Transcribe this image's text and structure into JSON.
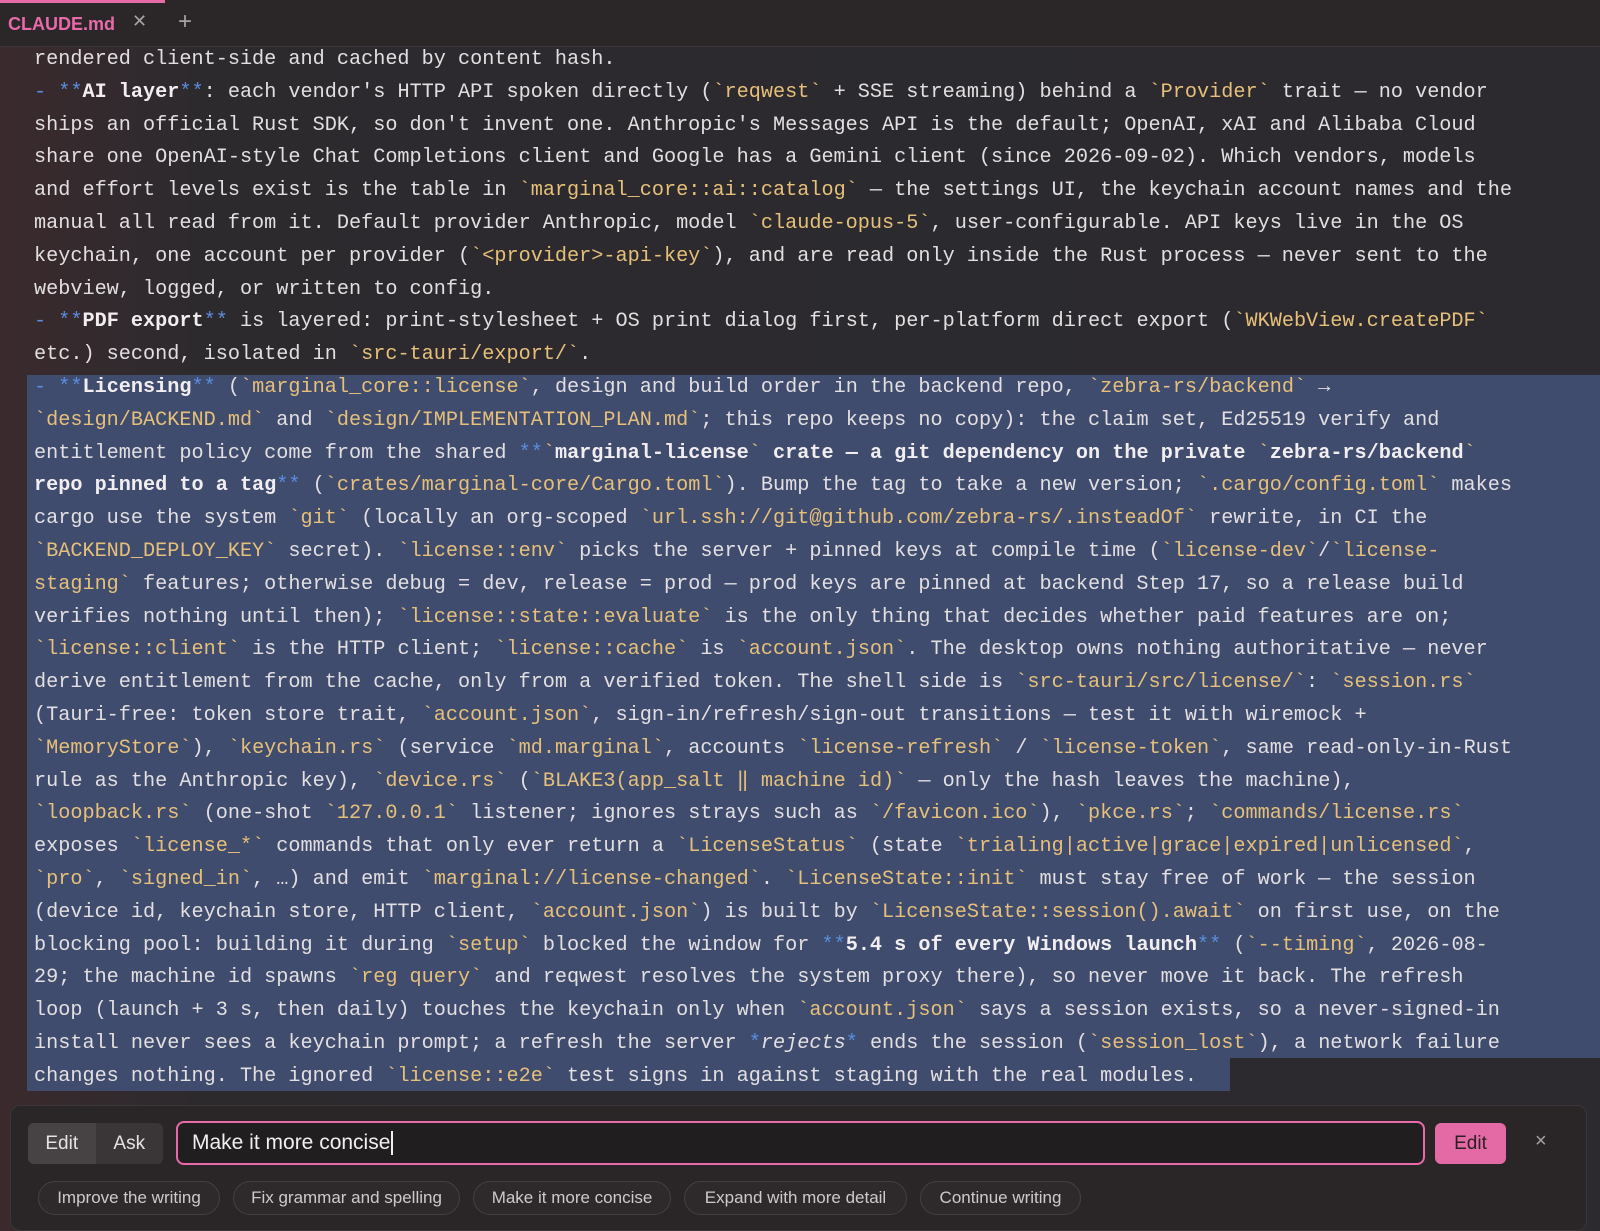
{
  "tabs": [
    {
      "label": "CLAUDE.md",
      "active": true
    }
  ],
  "icons": {
    "tab_close": "close-icon",
    "tab_add": "plus-icon",
    "panel_close": "close-icon"
  },
  "colors": {
    "accent": "#e86aa8",
    "code": "#e6c07a",
    "selection": "#3f4c6e"
  },
  "editor_lines": [
    [
      [
        "t",
        "rendered client-side and cached by content hash."
      ]
    ],
    [
      [
        "m",
        "- "
      ],
      [
        "m",
        "**"
      ],
      [
        "b",
        "AI layer"
      ],
      [
        "m",
        "**"
      ],
      [
        "t",
        ": each vendor's HTTP API spoken directly ("
      ],
      [
        "c",
        "`reqwest`"
      ],
      [
        "t",
        " + SSE streaming) behind a "
      ],
      [
        "c",
        "`Provider`"
      ],
      [
        "t",
        " trait — no vendor"
      ]
    ],
    [
      [
        "t",
        "ships an official Rust SDK, so don't invent one. Anthropic's Messages API is the default; OpenAI, xAI and Alibaba Cloud"
      ]
    ],
    [
      [
        "t",
        "share one OpenAI-style Chat Completions client and Google has a Gemini client (since 2026-09-02). Which vendors, models"
      ]
    ],
    [
      [
        "t",
        "and effort levels exist is the table in "
      ],
      [
        "c",
        "`marginal_core::ai::catalog`"
      ],
      [
        "t",
        " — the settings UI, the keychain account names and the"
      ]
    ],
    [
      [
        "t",
        "manual all read from it. Default provider Anthropic, model "
      ],
      [
        "c",
        "`claude-opus-5`"
      ],
      [
        "t",
        ", user-configurable. API keys live in the OS"
      ]
    ],
    [
      [
        "t",
        "keychain, one account per provider ("
      ],
      [
        "c",
        "`<provider>-api-key`"
      ],
      [
        "t",
        "), and are read only inside the Rust process — never sent to the"
      ]
    ],
    [
      [
        "t",
        "webview, logged, or written to config."
      ]
    ],
    [
      [
        "m",
        "- "
      ],
      [
        "m",
        "**"
      ],
      [
        "b",
        "PDF export"
      ],
      [
        "m",
        "**"
      ],
      [
        "t",
        " is layered: print-stylesheet + OS print dialog first, per-platform direct export ("
      ],
      [
        "c",
        "`WKWebView.createPDF`"
      ]
    ],
    [
      [
        "t",
        "etc.) second, isolated in "
      ],
      [
        "c",
        "`src-tauri/export/`"
      ],
      [
        "t",
        "."
      ]
    ],
    [
      [
        "m",
        "- "
      ],
      [
        "m",
        "**"
      ],
      [
        "b",
        "Licensing"
      ],
      [
        "m",
        "**"
      ],
      [
        "t",
        " ("
      ],
      [
        "c",
        "`marginal_core::license`"
      ],
      [
        "t",
        ", design and build order in the backend repo, "
      ],
      [
        "c",
        "`zebra-rs/backend`"
      ],
      [
        "t",
        " →"
      ]
    ],
    [
      [
        "c",
        "`design/BACKEND.md`"
      ],
      [
        "t",
        " and "
      ],
      [
        "c",
        "`design/IMPLEMENTATION_PLAN.md`"
      ],
      [
        "t",
        "; this repo keeps no copy): the claim set, Ed25519 verify and"
      ]
    ],
    [
      [
        "t",
        "entitlement policy come from the shared "
      ],
      [
        "m",
        "**"
      ],
      [
        "c",
        "`"
      ],
      [
        "b",
        "marginal-license"
      ],
      [
        "c",
        "`"
      ],
      [
        "b",
        " crate — a git dependency on the private "
      ],
      [
        "c",
        "`"
      ],
      [
        "b",
        "zebra-rs/backend"
      ],
      [
        "c",
        "`"
      ]
    ],
    [
      [
        "b",
        "repo pinned to a tag"
      ],
      [
        "m",
        "**"
      ],
      [
        "t",
        " ("
      ],
      [
        "c",
        "`crates/marginal-core/Cargo.toml`"
      ],
      [
        "t",
        "). Bump the tag to take a new version; "
      ],
      [
        "c",
        "`.cargo/config.toml`"
      ],
      [
        "t",
        " makes"
      ]
    ],
    [
      [
        "t",
        "cargo use the system "
      ],
      [
        "c",
        "`git`"
      ],
      [
        "t",
        " (locally an org-scoped "
      ],
      [
        "c",
        "`url.ssh://git@github.com/zebra-rs/.insteadOf`"
      ],
      [
        "t",
        " rewrite, in CI the"
      ]
    ],
    [
      [
        "c",
        "`BACKEND_DEPLOY_KEY`"
      ],
      [
        "t",
        " secret). "
      ],
      [
        "c",
        "`license::env`"
      ],
      [
        "t",
        " picks the server + pinned keys at compile time ("
      ],
      [
        "c",
        "`license-dev`"
      ],
      [
        "t",
        "/"
      ],
      [
        "c",
        "`license-"
      ]
    ],
    [
      [
        "c",
        "staging`"
      ],
      [
        "t",
        " features; otherwise debug = dev, release = prod — prod keys are pinned at backend Step 17, so a release build"
      ]
    ],
    [
      [
        "t",
        "verifies nothing until then); "
      ],
      [
        "c",
        "`license::state::evaluate`"
      ],
      [
        "t",
        " is the only thing that decides whether paid features are on;"
      ]
    ],
    [
      [
        "c",
        "`license::client`"
      ],
      [
        "t",
        " is the HTTP client; "
      ],
      [
        "c",
        "`license::cache`"
      ],
      [
        "t",
        " is "
      ],
      [
        "c",
        "`account.json`"
      ],
      [
        "t",
        ". The desktop owns nothing authoritative — never"
      ]
    ],
    [
      [
        "t",
        "derive entitlement from the cache, only from a verified token. The shell side is "
      ],
      [
        "c",
        "`src-tauri/src/license/`"
      ],
      [
        "t",
        ": "
      ],
      [
        "c",
        "`session.rs`"
      ]
    ],
    [
      [
        "t",
        "(Tauri-free: token store trait, "
      ],
      [
        "c",
        "`account.json`"
      ],
      [
        "t",
        ", sign-in/refresh/sign-out transitions — test it with wiremock +"
      ]
    ],
    [
      [
        "c",
        "`MemoryStore`"
      ],
      [
        "t",
        "), "
      ],
      [
        "c",
        "`keychain.rs`"
      ],
      [
        "t",
        " (service "
      ],
      [
        "c",
        "`md.marginal`"
      ],
      [
        "t",
        ", accounts "
      ],
      [
        "c",
        "`license-refresh`"
      ],
      [
        "t",
        " / "
      ],
      [
        "c",
        "`license-token`"
      ],
      [
        "t",
        ", same read-only-in-Rust"
      ]
    ],
    [
      [
        "t",
        "rule as the Anthropic key), "
      ],
      [
        "c",
        "`device.rs`"
      ],
      [
        "t",
        " ("
      ],
      [
        "c",
        "`BLAKE3(app_salt ‖ machine id)`"
      ],
      [
        "t",
        " — only the hash leaves the machine),"
      ]
    ],
    [
      [
        "c",
        "`loopback.rs`"
      ],
      [
        "t",
        " (one-shot "
      ],
      [
        "c",
        "`127.0.0.1`"
      ],
      [
        "t",
        " listener; ignores strays such as "
      ],
      [
        "c",
        "`/favicon.ico`"
      ],
      [
        "t",
        "), "
      ],
      [
        "c",
        "`pkce.rs`"
      ],
      [
        "t",
        "; "
      ],
      [
        "c",
        "`commands/license.rs`"
      ]
    ],
    [
      [
        "t",
        "exposes "
      ],
      [
        "c",
        "`license_*`"
      ],
      [
        "t",
        " commands that only ever return a "
      ],
      [
        "c",
        "`LicenseStatus`"
      ],
      [
        "t",
        " (state "
      ],
      [
        "c",
        "`trialing|active|grace|expired|unlicensed`"
      ],
      [
        "t",
        ","
      ]
    ],
    [
      [
        "c",
        "`pro`"
      ],
      [
        "t",
        ", "
      ],
      [
        "c",
        "`signed_in`"
      ],
      [
        "t",
        ", …) and emit "
      ],
      [
        "c",
        "`marginal://license-changed`"
      ],
      [
        "t",
        ". "
      ],
      [
        "c",
        "`LicenseState::init`"
      ],
      [
        "t",
        " must stay free of work — the session"
      ]
    ],
    [
      [
        "t",
        "(device id, keychain store, HTTP client, "
      ],
      [
        "c",
        "`account.json`"
      ],
      [
        "t",
        ") is built by "
      ],
      [
        "c",
        "`LicenseState::session().await`"
      ],
      [
        "t",
        " on first use, on the"
      ]
    ],
    [
      [
        "t",
        "blocking pool: building it during "
      ],
      [
        "c",
        "`setup`"
      ],
      [
        "t",
        " blocked the window for "
      ],
      [
        "m",
        "**"
      ],
      [
        "b",
        "5.4 s of every Windows launch"
      ],
      [
        "m",
        "**"
      ],
      [
        "t",
        " ("
      ],
      [
        "c",
        "`--timing`"
      ],
      [
        "t",
        ", 2026-08-"
      ]
    ],
    [
      [
        "t",
        "29; the machine id spawns "
      ],
      [
        "c",
        "`reg query`"
      ],
      [
        "t",
        " and reqwest resolves the system proxy there), so never move it back. The refresh"
      ]
    ],
    [
      [
        "t",
        "loop (launch + 3 s, then daily) touches the keychain only when "
      ],
      [
        "c",
        "`account.json`"
      ],
      [
        "t",
        " says a session exists, so a never-signed-in"
      ]
    ],
    [
      [
        "t",
        "install never sees a keychain prompt; a refresh the server "
      ],
      [
        "m",
        "*"
      ],
      [
        "i",
        "rejects"
      ],
      [
        "m",
        "*"
      ],
      [
        "t",
        " ends the session ("
      ],
      [
        "c",
        "`session_lost`"
      ],
      [
        "t",
        "), a network failure"
      ]
    ],
    [
      [
        "t",
        "changes nothing. The ignored "
      ],
      [
        "c",
        "`license::e2e`"
      ],
      [
        "t",
        " test signs in against staging with the real modules."
      ]
    ]
  ],
  "assistant": {
    "modes": [
      {
        "label": "Edit",
        "active": true
      },
      {
        "label": "Ask",
        "active": false
      }
    ],
    "prompt_value": "Make it more concise",
    "submit_label": "Edit",
    "close_label": "×",
    "suggestions": [
      "Improve the writing",
      "Fix grammar and spelling",
      "Make it more concise",
      "Expand with more detail",
      "Continue writing"
    ]
  }
}
